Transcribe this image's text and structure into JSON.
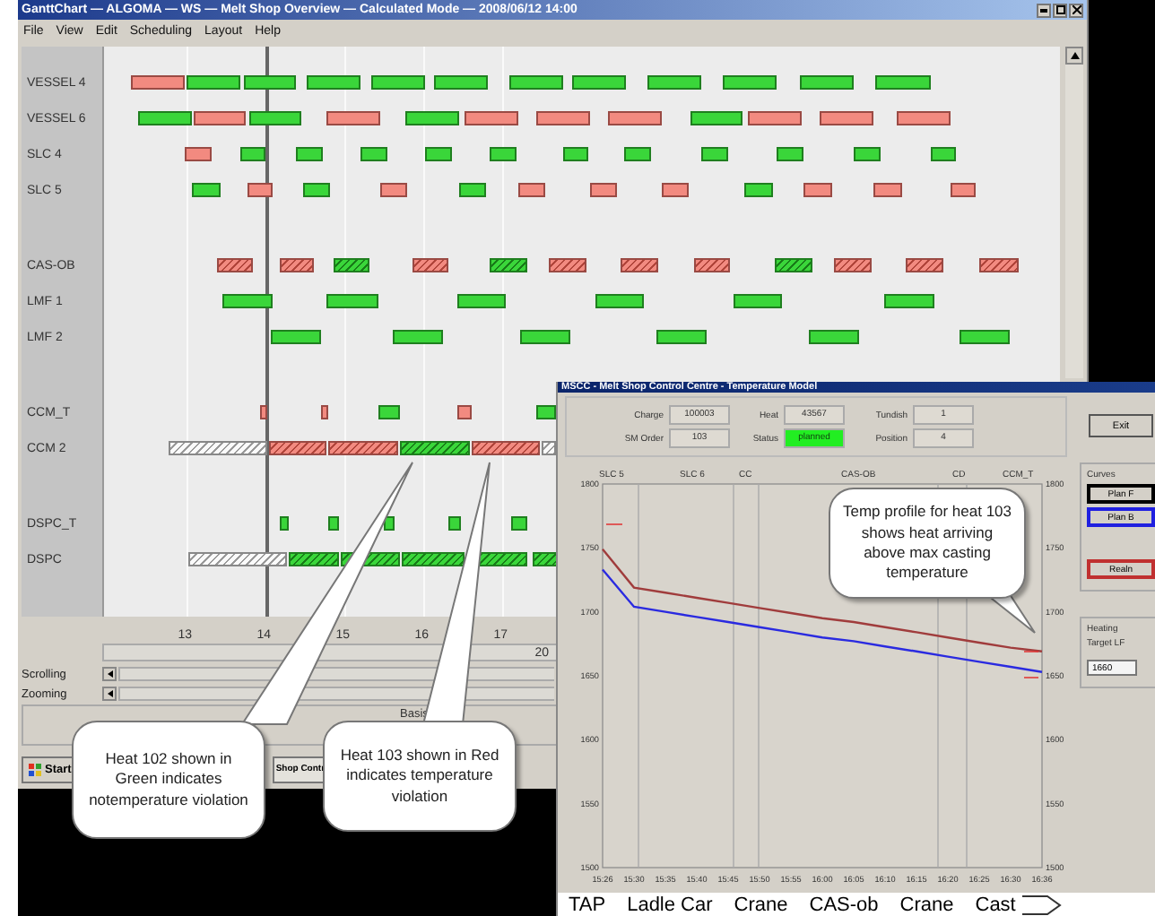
{
  "gantt_window": {
    "title": "GanttChart — ALGOMA — WS — Melt Shop Overview — Calculated Mode — 2008/06/12 14:00",
    "menu": [
      "File",
      "View",
      "Edit",
      "Scheduling",
      "Layout",
      "Help"
    ],
    "row_groups": [
      {
        "rows": [
          "VESSEL 4",
          "VESSEL 6",
          "SLC 4",
          "SLC 5"
        ]
      },
      {
        "rows": [
          "CAS-OB",
          "LMF 1",
          "LMF 2"
        ]
      },
      {
        "rows": [
          "CCM_T",
          "CCM 2"
        ]
      },
      {
        "rows": [
          "DSPC_T",
          "DSPC"
        ]
      }
    ],
    "axis_ticks": [
      "13",
      "14",
      "15",
      "16",
      "17"
    ],
    "date_label": "20",
    "scrolling_label": "Scrolling",
    "zooming_label": "Zooming",
    "basis_label": "Basis"
  },
  "taskbar": {
    "start": "Start",
    "tasks": [
      "Shop Contr"
    ]
  },
  "temperature_window": {
    "title": "MSCC - Melt Shop Control Centre - Temperature Model",
    "fields": [
      {
        "label": "Charge",
        "value": "100003",
        "kind": "plain"
      },
      {
        "label": "Heat",
        "value": "43567",
        "kind": "plain"
      },
      {
        "label": "Tundish",
        "value": "1",
        "kind": "plain"
      },
      {
        "label": "SM Order",
        "value": "103",
        "kind": "plain"
      },
      {
        "label": "Status",
        "value": "planned",
        "kind": "status"
      },
      {
        "label": "Position",
        "value": "4",
        "kind": "plain"
      }
    ],
    "stage_labels": [
      "SLC 5",
      "SLC 6",
      "CC",
      "CAS-OB",
      "CD",
      "CCM_T"
    ],
    "chart_data": {
      "type": "line",
      "categories": [
        "15:26",
        "15:30",
        "15:35",
        "15:40",
        "15:45",
        "15:50",
        "15:55",
        "16:00",
        "16:05",
        "16:10",
        "16:15",
        "16:20",
        "16:25",
        "16:30",
        "16:36"
      ],
      "ylim": [
        1500,
        1800
      ],
      "yticks": [
        1500,
        1550,
        1600,
        1650,
        1700,
        1750,
        1800
      ],
      "series": [
        {
          "color": "#a03c3c",
          "values": [
            1749,
            1719,
            1715,
            1711,
            1707,
            1703,
            1699,
            1695,
            1692,
            1688,
            1684,
            1680,
            1676,
            1672,
            1669
          ]
        },
        {
          "color": "#2a2ae0",
          "values": [
            1733,
            1704,
            1700,
            1696,
            1692,
            1688,
            1684,
            1680,
            1677,
            1673,
            1669,
            1665,
            1661,
            1657,
            1653
          ]
        }
      ]
    },
    "right_axis_labels": [
      "1800",
      "1750",
      "1700",
      "1650",
      "1600",
      "1550",
      "1500"
    ],
    "exit_button": "Exit",
    "curves_title": "Curves",
    "curve_buttons": [
      {
        "label": "Plan F",
        "color": "#000000"
      },
      {
        "label": "Plan B",
        "color": "#2020e0"
      },
      {
        "label": "Realn",
        "color": "#c03030"
      }
    ],
    "heating_title": "Heating",
    "target_label": "Target LF",
    "target_value": "1660",
    "process_steps": [
      "TAP",
      "Ladle Car",
      "Crane",
      "CAS-ob",
      "Crane",
      "Cast"
    ]
  },
  "callouts": [
    {
      "text": "Heat 102 shown in Green indicates notemperature violation"
    },
    {
      "text": "Heat 103 shown in Red indicates temperature violation"
    },
    {
      "text": "Temp profile for heat 103 shows heat arriving above max casting temperature"
    }
  ]
}
